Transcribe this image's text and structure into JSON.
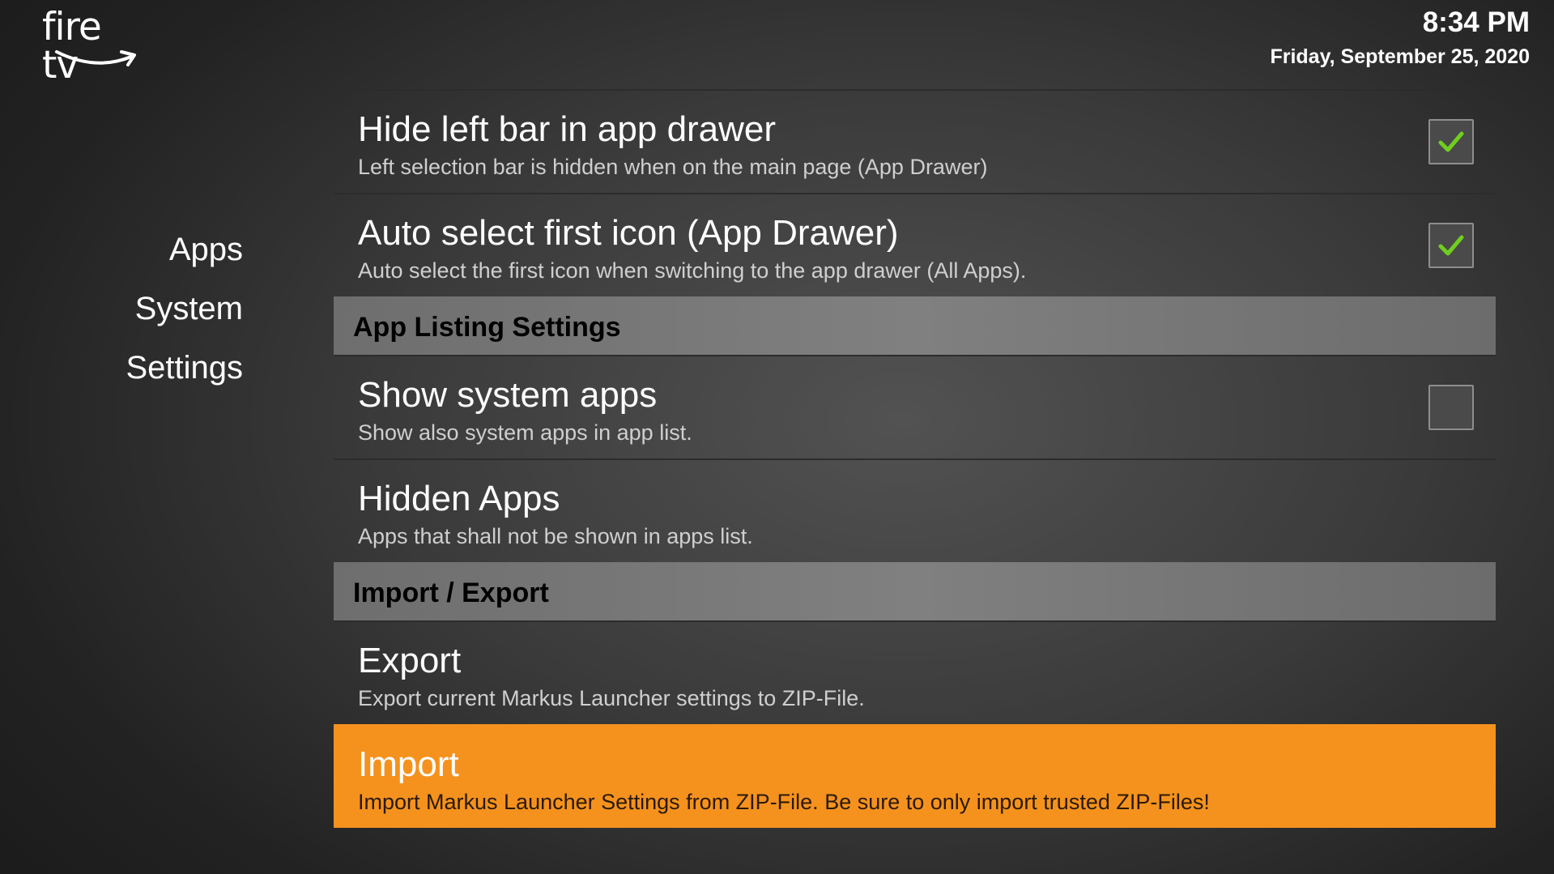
{
  "brand": {
    "logo_text": "fire tv",
    "icon": "amazon-smile-icon"
  },
  "clock": {
    "time": "8:34 PM",
    "date": "Friday, September 25, 2020"
  },
  "nav": {
    "items": [
      "Apps",
      "System",
      "Settings"
    ]
  },
  "settings": {
    "hide_left_bar": {
      "title": "Hide left bar in app drawer",
      "description": "Left selection bar is hidden when on the main page (App Drawer)",
      "checked": true
    },
    "auto_select_first": {
      "title": "Auto select first icon (App Drawer)",
      "description": "Auto select the first icon when switching to the app drawer (All Apps).",
      "checked": true
    },
    "section_app_listing": "App Listing Settings",
    "show_system_apps": {
      "title": "Show system apps",
      "description": "Show also system apps in app list.",
      "checked": false
    },
    "hidden_apps": {
      "title": "Hidden Apps",
      "description": "Apps that shall not be shown in apps list."
    },
    "section_import_export": "Import / Export",
    "export": {
      "title": "Export",
      "description": "Export current Markus Launcher settings to ZIP-File."
    },
    "import": {
      "title": "Import",
      "description": "Import Markus Launcher Settings from ZIP-File. Be sure to only import trusted ZIP-Files!"
    }
  },
  "colors": {
    "accent_orange": "#f5921e",
    "check_green": "#6fcf1f",
    "section_gray": "#7a7a7a"
  }
}
